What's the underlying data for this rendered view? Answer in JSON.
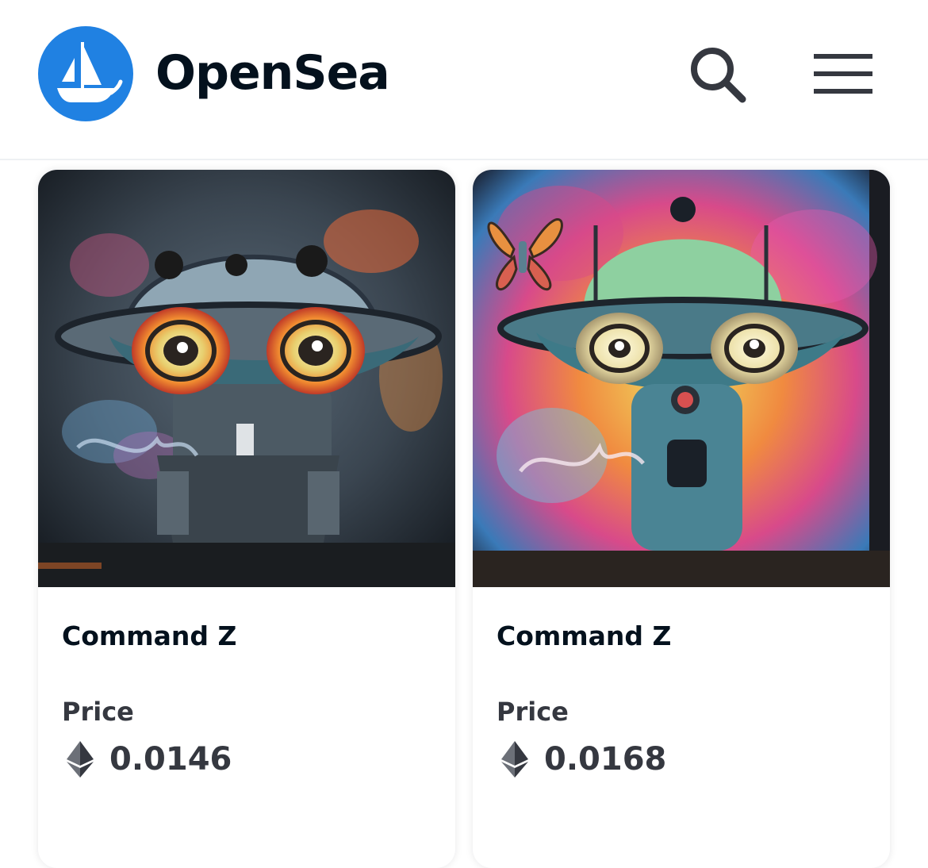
{
  "header": {
    "brand_name": "OpenSea",
    "logo_icon": "opensea-ship-logo-icon",
    "search_icon": "search-icon",
    "menu_icon": "hamburger-menu-icon",
    "accent_color": "#2081e2"
  },
  "listings": [
    {
      "name": "Command Z",
      "price_label": "Price",
      "price_value": "0.0146",
      "currency_icon": "ethereum-icon"
    },
    {
      "name": "Command Z",
      "price_label": "Price",
      "price_value": "0.0168",
      "currency_icon": "ethereum-icon"
    }
  ]
}
